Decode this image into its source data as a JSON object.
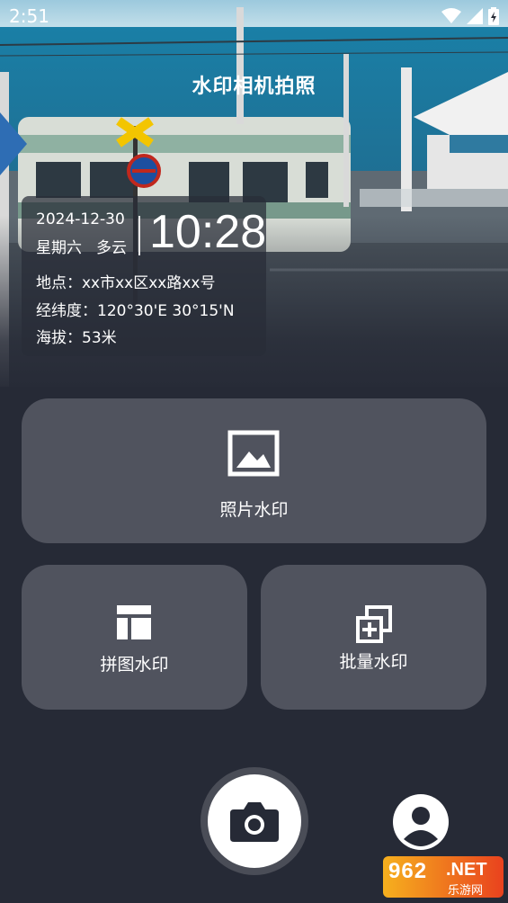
{
  "status_bar": {
    "time": "2:51"
  },
  "header": {
    "title": "水印相机拍照"
  },
  "watermark": {
    "date": "2024-12-30",
    "weekday": "星期六",
    "weather": "多云",
    "time": "10:28",
    "location": "地点：xx市xx区xx路xx号",
    "coordinates": "经纬度：120°30'E 30°15'N",
    "altitude": "海拔：53米"
  },
  "actions": {
    "photo": "照片水印",
    "collage": "拼图水印",
    "batch": "批量水印"
  },
  "badge": {
    "number": "962",
    "suffix": ".NET",
    "site": "乐游网"
  },
  "colors": {
    "background": "#262a36",
    "tile": "#50535e",
    "accent": "#ffffff"
  }
}
